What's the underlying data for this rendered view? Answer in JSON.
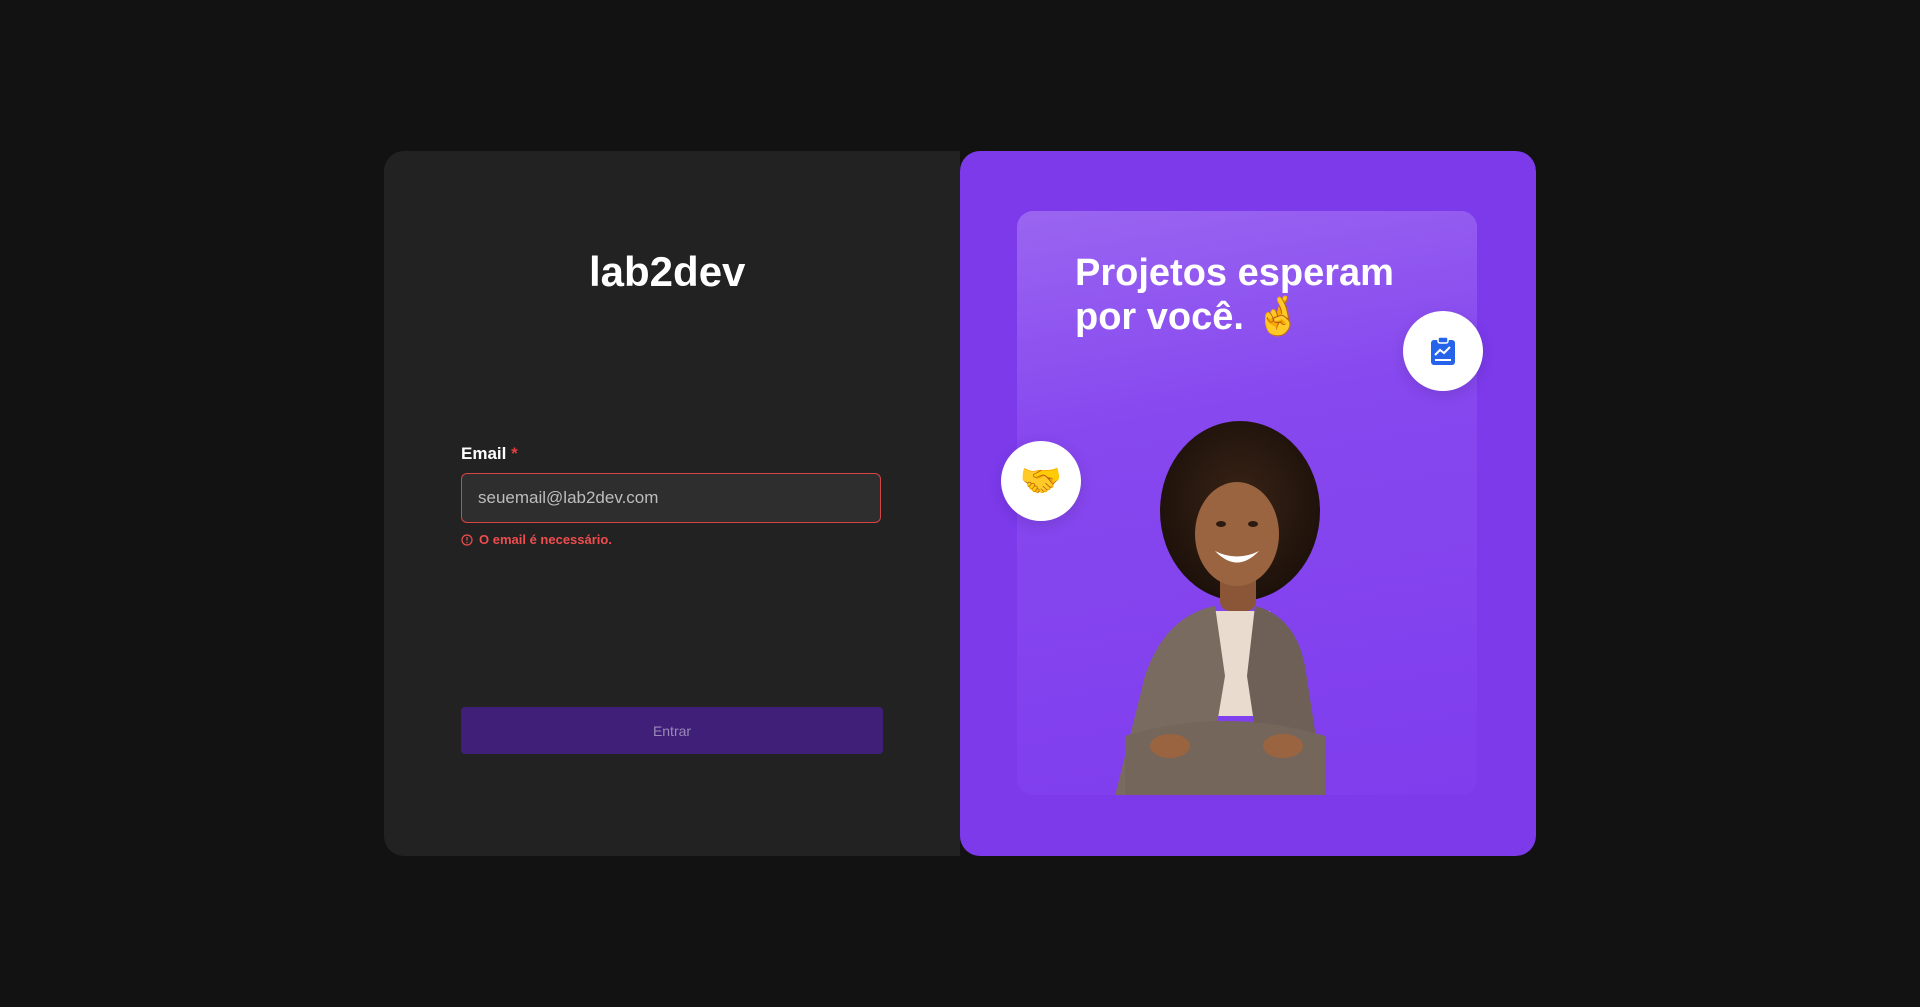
{
  "brand": {
    "logo_text": "lab2dev"
  },
  "login": {
    "email_label": "Email",
    "required_marker": "*",
    "email_placeholder": "seuemail@lab2dev.com",
    "email_value": "",
    "error_message": "O email é necessário.",
    "submit_label": "Entrar"
  },
  "promo": {
    "headline_line1": "Projetos esperam",
    "headline_line2": "por você.",
    "headline_emoji": "🤞",
    "chart_icon": "clipboard-chart-icon",
    "handshake_emoji": "🤝"
  },
  "colors": {
    "background": "#121212",
    "left_panel": "#222222",
    "right_panel": "#7c3aeb",
    "error": "#e53e3e",
    "button": "#3f1f78",
    "icon_blue": "#2563eb"
  }
}
